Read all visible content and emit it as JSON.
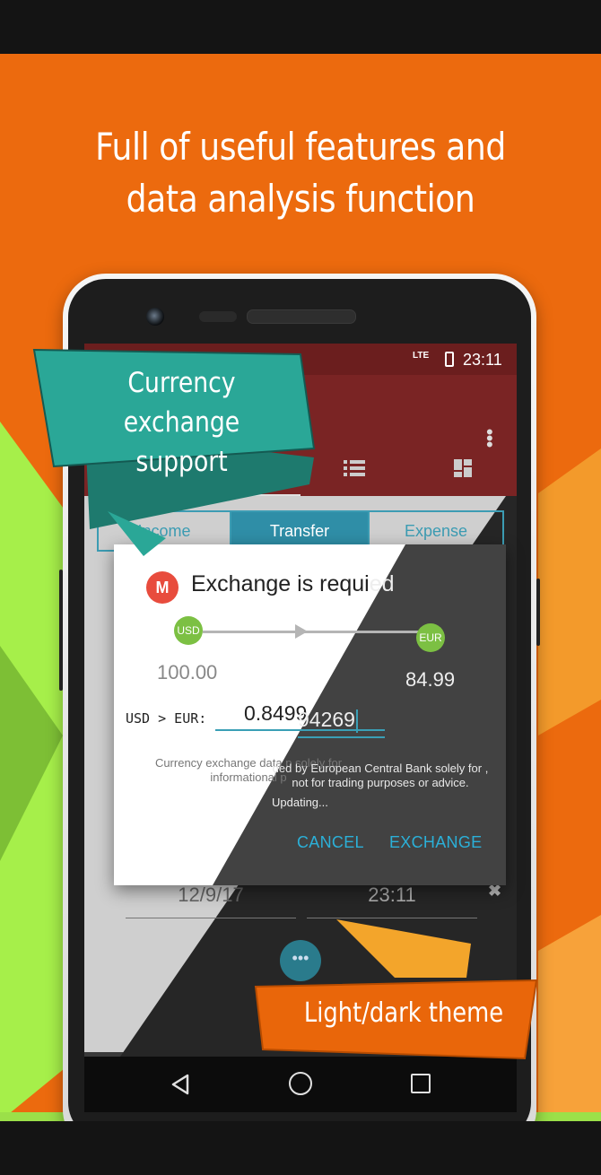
{
  "headline": {
    "line1": "Full of useful features and",
    "line2": "data analysis function"
  },
  "callouts": {
    "currency_line1": "Currency exchange",
    "currency_line2": "support",
    "theme": "Light/dark theme"
  },
  "statusbar": {
    "network": "LTE",
    "time": "23:11"
  },
  "segments": [
    "Income",
    "Transfer",
    "Expense"
  ],
  "form": {
    "date": "12/9/17",
    "time": "23:11"
  },
  "dialog": {
    "title": "Exchange is required",
    "title_light": "Exchange is requi",
    "title_dark": "ed",
    "from_currency": "USD",
    "to_currency": "EUR",
    "from_amount": "100.00",
    "to_amount": "84.99",
    "pair_label": "USD > EUR:",
    "rate_light": "0.8499",
    "rate_dark": "94269",
    "disclaimer_light": "Currency exchange data p solely for informational p",
    "disclaimer_dark": "ded by European Central Bank solely for , not for trading purposes or advice.",
    "status": "Updating...",
    "cancel": "CANCEL",
    "exchange": "EXCHANGE"
  },
  "colors": {
    "background": "#ec6a0e",
    "green": "#a6ef4a",
    "teal": "#2aa797",
    "accent": "#2bb0d8",
    "appbar": "#7a2424"
  },
  "icons": [
    "back-icon",
    "home-icon",
    "recents-icon",
    "kebab-menu-icon",
    "list-tab-icon",
    "dashboard-tab-icon"
  ]
}
